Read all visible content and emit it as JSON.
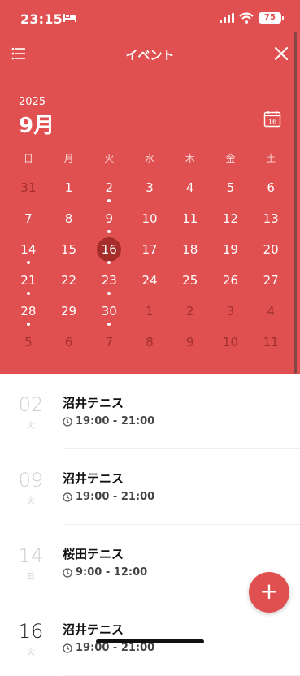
{
  "status_bar": {
    "time": "23:15",
    "battery": "75"
  },
  "nav": {
    "title": "イベント"
  },
  "calendar": {
    "year": "2025",
    "month": "9月",
    "today_icon_label": "16",
    "weekdays": [
      "日",
      "月",
      "火",
      "水",
      "木",
      "金",
      "土"
    ],
    "days": [
      {
        "d": "31",
        "muted": true,
        "dot": false
      },
      {
        "d": "1",
        "muted": false,
        "dot": false
      },
      {
        "d": "2",
        "muted": false,
        "dot": true
      },
      {
        "d": "3",
        "muted": false,
        "dot": false
      },
      {
        "d": "4",
        "muted": false,
        "dot": false
      },
      {
        "d": "5",
        "muted": false,
        "dot": false
      },
      {
        "d": "6",
        "muted": false,
        "dot": false
      },
      {
        "d": "7",
        "muted": false,
        "dot": false
      },
      {
        "d": "8",
        "muted": false,
        "dot": false
      },
      {
        "d": "9",
        "muted": false,
        "dot": true
      },
      {
        "d": "10",
        "muted": false,
        "dot": false
      },
      {
        "d": "11",
        "muted": false,
        "dot": false
      },
      {
        "d": "12",
        "muted": false,
        "dot": false
      },
      {
        "d": "13",
        "muted": false,
        "dot": false
      },
      {
        "d": "14",
        "muted": false,
        "dot": true
      },
      {
        "d": "15",
        "muted": false,
        "dot": false
      },
      {
        "d": "16",
        "muted": false,
        "dot": true,
        "selected": true
      },
      {
        "d": "17",
        "muted": false,
        "dot": false
      },
      {
        "d": "18",
        "muted": false,
        "dot": false
      },
      {
        "d": "19",
        "muted": false,
        "dot": false
      },
      {
        "d": "20",
        "muted": false,
        "dot": false
      },
      {
        "d": "21",
        "muted": false,
        "dot": true
      },
      {
        "d": "22",
        "muted": false,
        "dot": false
      },
      {
        "d": "23",
        "muted": false,
        "dot": true
      },
      {
        "d": "24",
        "muted": false,
        "dot": false
      },
      {
        "d": "25",
        "muted": false,
        "dot": false
      },
      {
        "d": "26",
        "muted": false,
        "dot": false
      },
      {
        "d": "27",
        "muted": false,
        "dot": false
      },
      {
        "d": "28",
        "muted": false,
        "dot": true
      },
      {
        "d": "29",
        "muted": false,
        "dot": false
      },
      {
        "d": "30",
        "muted": false,
        "dot": true
      },
      {
        "d": "1",
        "muted": true,
        "dot": false
      },
      {
        "d": "2",
        "muted": true,
        "dot": false
      },
      {
        "d": "3",
        "muted": true,
        "dot": false
      },
      {
        "d": "4",
        "muted": true,
        "dot": false
      },
      {
        "d": "5",
        "muted": true,
        "dot": false
      },
      {
        "d": "6",
        "muted": true,
        "dot": false
      },
      {
        "d": "7",
        "muted": true,
        "dot": false
      },
      {
        "d": "8",
        "muted": true,
        "dot": false
      },
      {
        "d": "9",
        "muted": true,
        "dot": false
      },
      {
        "d": "10",
        "muted": true,
        "dot": false
      },
      {
        "d": "11",
        "muted": true,
        "dot": false
      }
    ]
  },
  "events": [
    {
      "day": "02",
      "weekday": "火",
      "title": "沼井テニス",
      "time": "19:00 - 21:00"
    },
    {
      "day": "09",
      "weekday": "火",
      "title": "沼井テニス",
      "time": "19:00 - 21:00"
    },
    {
      "day": "14",
      "weekday": "日",
      "title": "桜田テニス",
      "time": "9:00 - 12:00"
    },
    {
      "day": "16",
      "weekday": "火",
      "title": "沼井テニス",
      "time": "19:00 - 21:00"
    }
  ],
  "fab": {
    "label": "+"
  },
  "colors": {
    "accent": "#E15050",
    "selected_day": "#A62E2A"
  }
}
